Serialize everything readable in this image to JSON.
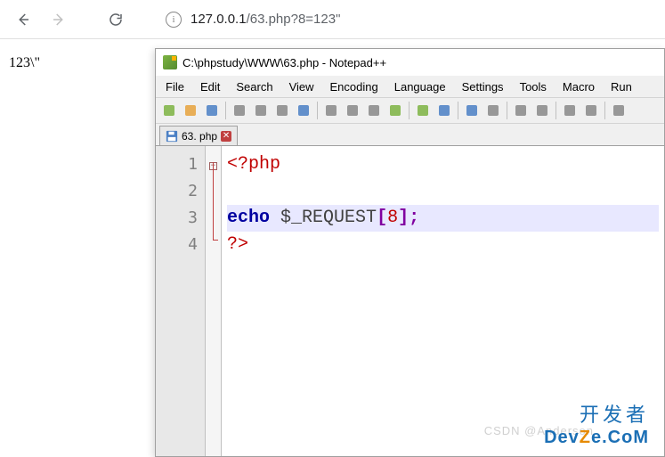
{
  "browser": {
    "url_host": "127.0.0.1",
    "url_path": "/63.php?8=123\""
  },
  "page_output": "123\\\"",
  "notepadpp": {
    "title": "C:\\phpstudy\\WWW\\63.php - Notepad++",
    "menu": [
      "File",
      "Edit",
      "Search",
      "View",
      "Encoding",
      "Language",
      "Settings",
      "Tools",
      "Macro",
      "Run"
    ],
    "tab": {
      "label": "63. php"
    },
    "toolbar_icons": [
      "new-file",
      "open-file",
      "save",
      "copy",
      "cut2",
      "paste",
      "print",
      "cut",
      "copy2",
      "paste2",
      "undo",
      "redo",
      "find",
      "replace",
      "zoom-in",
      "zoom-out",
      "sync",
      "wrap",
      "show-all",
      "indent"
    ],
    "code": {
      "lines": [
        {
          "n": "1",
          "tokens": [
            {
              "c": "tok-tag",
              "t": "<?php"
            }
          ]
        },
        {
          "n": "2",
          "tokens": []
        },
        {
          "n": "3",
          "hl": true,
          "tokens": [
            {
              "c": "tok-kw",
              "t": "echo"
            },
            {
              "c": "",
              "t": " "
            },
            {
              "c": "tok-var",
              "t": "$_REQUEST"
            },
            {
              "c": "tok-punc",
              "t": "["
            },
            {
              "c": "tok-num",
              "t": "8"
            },
            {
              "c": "tok-punc",
              "t": "]"
            },
            {
              "c": "tok-punc",
              "t": ";"
            }
          ]
        },
        {
          "n": "4",
          "tokens": [
            {
              "c": "tok-tag",
              "t": "?>"
            }
          ]
        }
      ]
    }
  },
  "watermark": {
    "cn": "开发者",
    "en_pre": "Dev",
    "en_z": "Z",
    "en_post": "e.CoM",
    "faint": "CSDN @Anderson"
  }
}
